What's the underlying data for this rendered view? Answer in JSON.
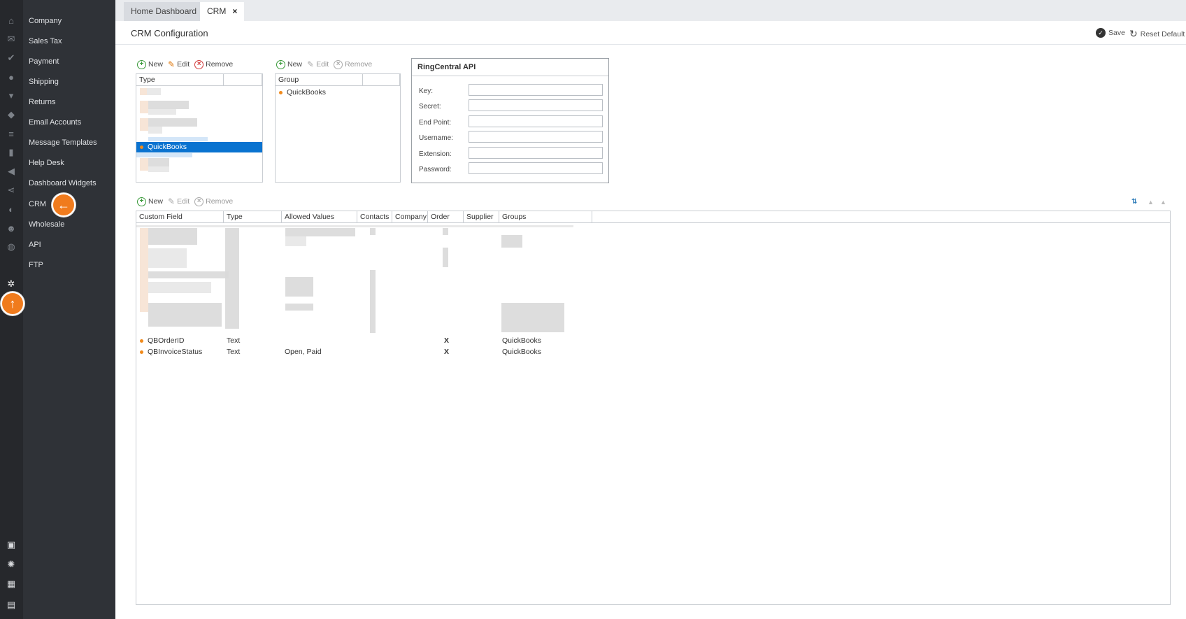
{
  "tabs": [
    {
      "label": "Home Dashboard"
    },
    {
      "label": "CRM",
      "close": "×"
    }
  ],
  "page_title": "CRM Configuration",
  "actions": {
    "save": "Save",
    "reset": "Reset Default"
  },
  "nav": {
    "items": [
      {
        "label": "Company"
      },
      {
        "label": "Sales Tax"
      },
      {
        "label": "Payment"
      },
      {
        "label": "Shipping"
      },
      {
        "label": "Returns"
      },
      {
        "label": "Email Accounts"
      },
      {
        "label": "Message Templates"
      },
      {
        "label": "Help Desk"
      },
      {
        "label": "Dashboard Widgets"
      },
      {
        "label": "CRM"
      },
      {
        "label": "Wholesale"
      },
      {
        "label": "API"
      },
      {
        "label": "FTP"
      }
    ]
  },
  "toolbar": {
    "new": "New",
    "edit": "Edit",
    "remove": "Remove"
  },
  "type_grid": {
    "columns": [
      "Type",
      ""
    ],
    "selected_row": "QuickBooks"
  },
  "group_grid": {
    "columns": [
      "Group",
      ""
    ],
    "rows": [
      "QuickBooks"
    ]
  },
  "ringcentral": {
    "title": "RingCentral API",
    "fields": [
      {
        "label": "Key:",
        "value": ""
      },
      {
        "label": "Secret:",
        "value": ""
      },
      {
        "label": "End Point:",
        "value": ""
      },
      {
        "label": "Username:",
        "value": ""
      },
      {
        "label": "Extension:",
        "value": ""
      },
      {
        "label": "Password:",
        "value": ""
      }
    ]
  },
  "custom_fields": {
    "columns": [
      "Custom Field",
      "Type",
      "Allowed Values",
      "Contacts",
      "Company",
      "Order",
      "Supplier",
      "Groups"
    ],
    "rows": [
      {
        "field": "QBOrderID",
        "type": "Text",
        "allowed": "",
        "contacts": "",
        "company": "",
        "order": "X",
        "supplier": "",
        "groups": "QuickBooks"
      },
      {
        "field": "QBInvoiceStatus",
        "type": "Text",
        "allowed": "Open, Paid",
        "contacts": "",
        "company": "",
        "order": "X",
        "supplier": "",
        "groups": "QuickBooks"
      }
    ]
  },
  "icons": {
    "rail": [
      "home-icon",
      "envelope-icon",
      "checklist-icon",
      "user-icon",
      "cart-icon",
      "tag-icon",
      "sliders-icon",
      "bar-chart-icon",
      "megaphone-icon",
      "share-icon",
      "palette-icon",
      "users-icon",
      "globe-icon",
      "gears-icon",
      "dashboard-icon",
      "lightbulb-icon",
      "grid-icon",
      "calendar-icon"
    ]
  },
  "colors": {
    "accent_orange": "#f07b1d",
    "selection_blue": "#0a73d0",
    "nav_bg": "#2f3237",
    "rail_bg": "#26282c"
  }
}
